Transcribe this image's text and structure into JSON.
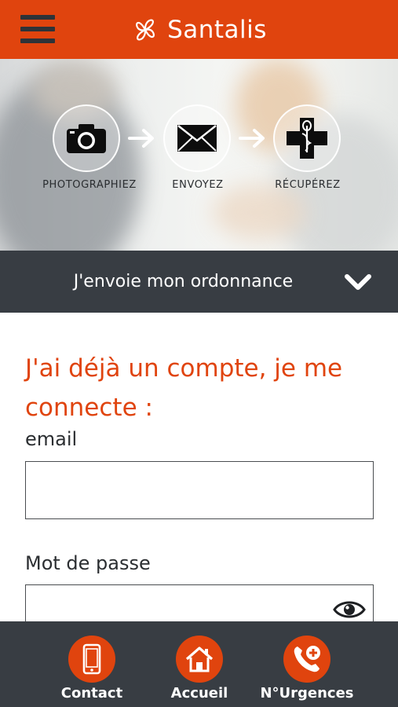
{
  "header": {
    "menu_icon": "hamburger-menu-icon",
    "logo_icon": "santalis-logo-icon",
    "brand_name": "Santalis"
  },
  "hero": {
    "steps": [
      {
        "label": "PHOTOGRAPHIEZ",
        "icon": "camera-icon"
      },
      {
        "label": "ENVOYEZ",
        "icon": "envelope-icon"
      },
      {
        "label": "RÉCUPÉREZ",
        "icon": "pharmacy-cross-icon"
      }
    ],
    "arrow_icon": "arrow-right-icon"
  },
  "prescription_bar": {
    "label": "J'envoie mon ordonnance",
    "icon": "chevron-down-icon"
  },
  "login": {
    "title": "J'ai déjà un compte, je me connecte :",
    "email_label": "email",
    "email_value": "",
    "password_label": "Mot de passe",
    "password_value": "",
    "show_password_icon": "eye-icon"
  },
  "bottom_nav": {
    "items": [
      {
        "label": "Contact",
        "icon": "phone-icon"
      },
      {
        "label": "Accueil",
        "icon": "home-icon"
      },
      {
        "label": "N°Urgences",
        "icon": "emergency-phone-icon"
      }
    ]
  },
  "colors": {
    "brand": "#e0440e",
    "dark": "#383d43",
    "white": "#ffffff"
  }
}
